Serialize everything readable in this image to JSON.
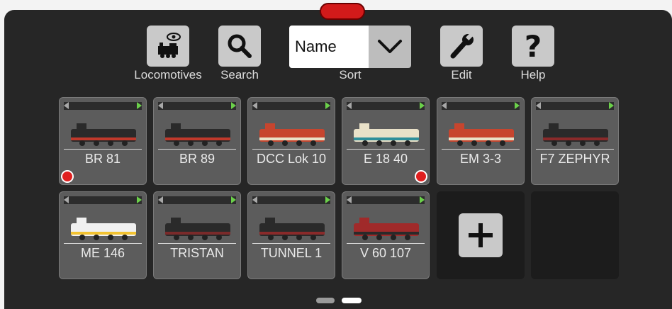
{
  "toolbar": {
    "locomotives_label": "Locomotives",
    "search_label": "Search",
    "sort_value": "Name",
    "sort_label": "Sort",
    "edit_label": "Edit",
    "help_label": "Help"
  },
  "locomotives": [
    {
      "name": "BR 81",
      "color": "#2a2a2a",
      "accent": "#c0392b",
      "indicator": "left"
    },
    {
      "name": "BR 89",
      "color": "#2a2a2a",
      "accent": "#c0392b",
      "indicator": ""
    },
    {
      "name": "DCC Lok 10",
      "color": "#c7452e",
      "accent": "#e9e1c8",
      "indicator": ""
    },
    {
      "name": "E 18 40",
      "color": "#e9e1c8",
      "accent": "#2f8f9a",
      "indicator": "right"
    },
    {
      "name": "EM 3-3",
      "color": "#c7452e",
      "accent": "#e9e1c8",
      "indicator": ""
    },
    {
      "name": "F7 ZEPHYR",
      "color": "#2a2a2a",
      "accent": "#8a2a2a",
      "indicator": ""
    },
    {
      "name": "ME 146",
      "color": "#f0f0f0",
      "accent": "#f2c230",
      "indicator": ""
    },
    {
      "name": "TRISTAN",
      "color": "#2a2a2a",
      "accent": "#7a2a2a",
      "indicator": ""
    },
    {
      "name": "TUNNEL 1",
      "color": "#2a2a2a",
      "accent": "#8a2a2a",
      "indicator": ""
    },
    {
      "name": "V 60 107",
      "color": "#a02a2a",
      "accent": "#2a2a2a",
      "indicator": ""
    }
  ],
  "colors": {
    "accent_red": "#d21a1a",
    "active_arrow": "#6bd04a",
    "pager_active": "#ffffff",
    "pager_inactive": "#9a9a9a"
  }
}
